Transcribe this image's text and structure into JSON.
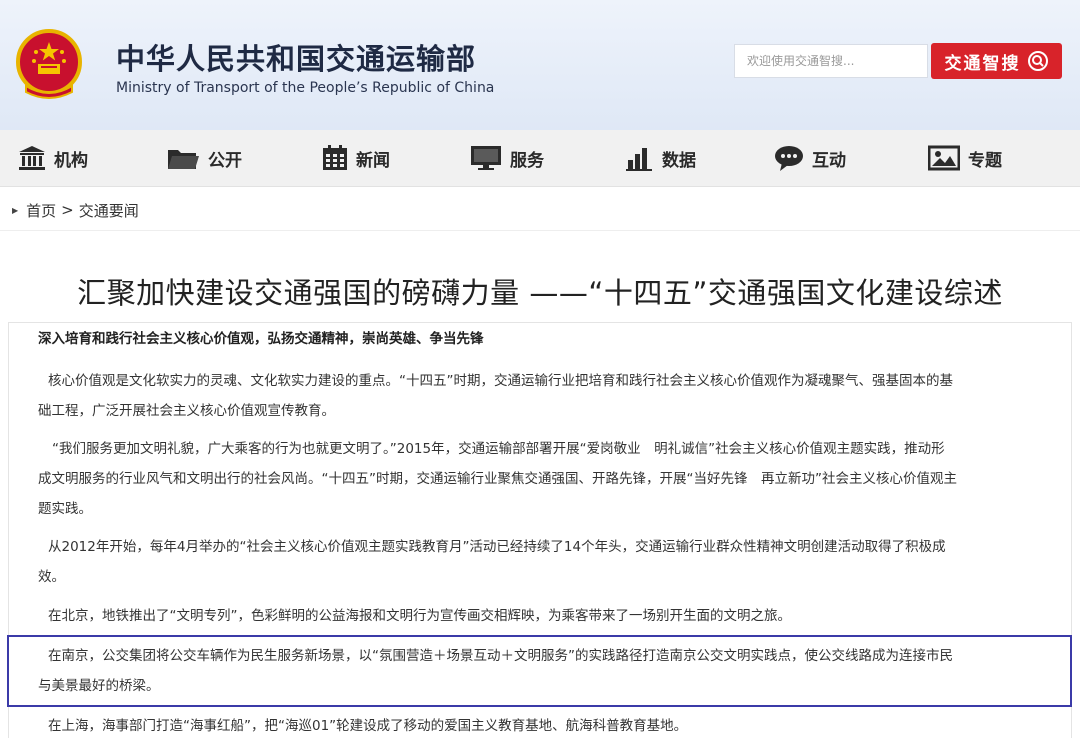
{
  "header": {
    "title_cn": "中华人民共和国交通运输部",
    "title_en": "Ministry of Transport of the People’s Republic of China",
    "search_placeholder": "欢迎使用交通智搜...",
    "search_button": "交通智搜"
  },
  "nav": {
    "items": [
      {
        "label": "机构",
        "icon": "building-icon"
      },
      {
        "label": "公开",
        "icon": "folder-icon"
      },
      {
        "label": "新闻",
        "icon": "calendar-icon"
      },
      {
        "label": "服务",
        "icon": "monitor-icon"
      },
      {
        "label": "数据",
        "icon": "bar-chart-icon"
      },
      {
        "label": "互动",
        "icon": "chat-bubble-icon"
      },
      {
        "label": "专题",
        "icon": "image-icon"
      }
    ]
  },
  "breadcrumb": {
    "home": "首页",
    "separator": ">",
    "current": "交通要闻"
  },
  "article": {
    "title": "汇聚加快建设交通强国的磅礴力量 ——“十四五”交通强国文化建设综述",
    "subheading": "深入培育和践行社会主义核心价值观，弘扬交通精神，崇尚英雄、争当先锋",
    "paragraphs": [
      [
        "核心价值观是文化软实力的灵魂、文化软实力建设的重点。“十四五”时期，交通运输行业把培育和践行社会主义核心价值观作为凝魂聚气、强基固本的基",
        "础工程，广泛开展社会主义核心价值观宣传教育。"
      ],
      [
        "“我们服务更加文明礼貌，广大乘客的行为也就更文明了。”2015年，交通运输部部署开展“爱岗敬业　明礼诚信”社会主义核心价值观主题实践，推动形",
        "成文明服务的行业风气和文明出行的社会风尚。“十四五”时期，交通运输行业聚焦交通强国、开路先锋，开展“当好先锋　再立新功”社会主义核心价值观主",
        "题实践。"
      ],
      [
        "从2012年开始，每年4月举办的“社会主义核心价值观主题实践教育月”活动已经持续了14个年头，交通运输行业群众性精神文明创建活动取得了积极成",
        "效。"
      ],
      [
        "在北京，地铁推出了“文明专列”，色彩鲜明的公益海报和文明行为宣传画交相辉映，为乘客带来了一场别开生面的文明之旅。"
      ],
      [
        "在南京，公交集团将公交车辆作为民生服务新场景，以“氛围营造＋场景互动＋文明服务”的实践路径打造南京公交文明实践点，使公交线路成为连接市民",
        "与美景最好的桥梁。"
      ],
      [
        "在上海，海事部门打造“海事红船”，把“海巡01”轮建设成了移动的爱国主义教育基地、航海科普教育基地。"
      ]
    ]
  },
  "colors": {
    "brand_red": "#d8232a",
    "highlight_border": "#3b3aa8",
    "header_bg": "#e6edf8"
  }
}
